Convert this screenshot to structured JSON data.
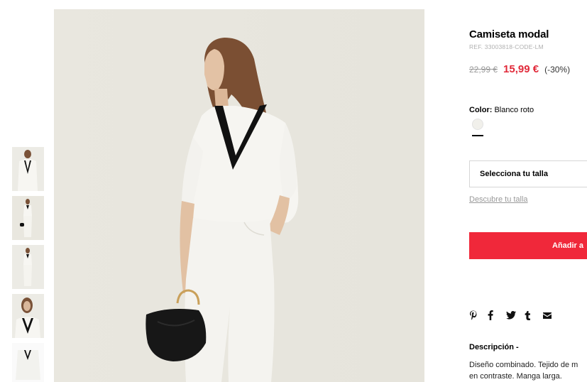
{
  "product": {
    "title": "Camiseta modal",
    "ref": "REF. 33003818-CODE-LM",
    "old_price": "22,99 €",
    "new_price": "15,99 €",
    "discount": "(-30%)"
  },
  "color": {
    "label": "Color:",
    "value": "Blanco roto",
    "swatch_color": "#f1f0eb"
  },
  "size": {
    "select_label": "Selecciona tu talla",
    "guide_link": "Descubre tu talla"
  },
  "cart": {
    "add_label": "Añadir a"
  },
  "share": {
    "icons": [
      "pinterest-icon",
      "facebook-icon",
      "twitter-icon",
      "tumblr-icon",
      "email-icon"
    ]
  },
  "description": {
    "title": "Descripción -",
    "line1": "Diseño combinado. Tejido de m",
    "line2": "en contraste. Manga larga."
  },
  "colors": {
    "accent": "#f0283a",
    "sale_price": "#e12a3a"
  }
}
